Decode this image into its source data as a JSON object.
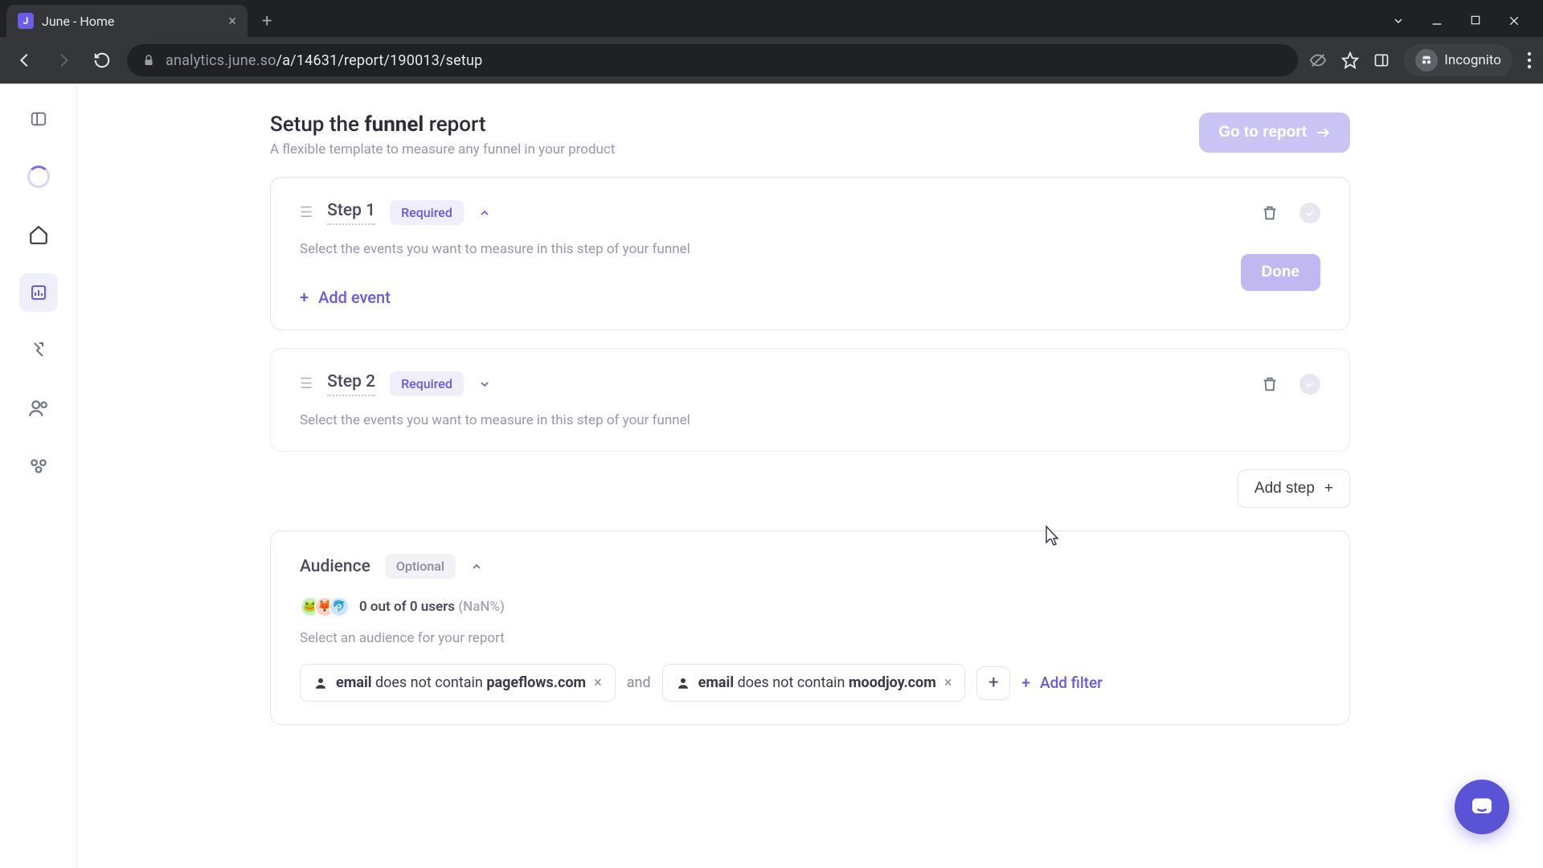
{
  "browser": {
    "tab_title": "June - Home",
    "url_host": "analytics.june.so",
    "url_path": "/a/14631/report/190013/setup",
    "incognito_label": "Incognito"
  },
  "header": {
    "title_pre": "Setup the ",
    "title_bold": "funnel",
    "title_post": " report",
    "subtitle": "A flexible template to measure any funnel in your product",
    "go_report": "Go to report"
  },
  "steps": [
    {
      "title": "Step 1",
      "badge": "Required",
      "sub": "Select the events you want to measure in this step of your funnel",
      "add_event": "Add event",
      "done": "Done",
      "expanded": true
    },
    {
      "title": "Step 2",
      "badge": "Required",
      "sub": "Select the events you want to measure in this step of your funnel",
      "expanded": false
    }
  ],
  "add_step": "Add step",
  "audience": {
    "title": "Audience",
    "badge": "Optional",
    "count_text": "0 out of 0 users",
    "pct": "(NaN%)",
    "sub": "Select an audience for your report",
    "filters": [
      {
        "field": "email",
        "op": "does not contain",
        "value": "pageflows.com"
      },
      {
        "field": "email",
        "op": "does not contain",
        "value": "moodjoy.com"
      }
    ],
    "conj": "and",
    "add_filter": "Add filter"
  }
}
